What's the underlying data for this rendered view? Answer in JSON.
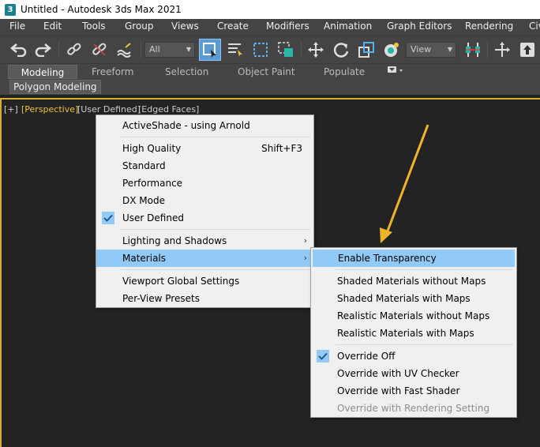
{
  "window": {
    "title": "Untitled - Autodesk 3ds Max 2021",
    "app_icon_text": "3"
  },
  "menubar": {
    "items": [
      "File",
      "Edit",
      "Tools",
      "Group",
      "Views",
      "Create",
      "Modifiers",
      "Animation",
      "Graph Editors",
      "Rendering",
      "Civ"
    ]
  },
  "toolbar": {
    "selection_filter": "All",
    "reference_coord": "View"
  },
  "ribbon": {
    "tabs": [
      "Modeling",
      "Freeform",
      "Selection",
      "Object Paint",
      "Populate"
    ],
    "active_tab": "Modeling",
    "sub_panel": "Polygon Modeling"
  },
  "viewport": {
    "label_plus": "[+]",
    "label_view": "[Perspective]",
    "label_shading": "[User Defined]",
    "label_edged": "[Edged Faces]",
    "border_color": "#d5ac2f",
    "arrow_color": "#f0b429"
  },
  "context_menu": {
    "items": [
      {
        "label": "ActiveShade - using Arnold"
      },
      {
        "label": "High Quality",
        "shortcut": "Shift+F3"
      },
      {
        "label": "Standard"
      },
      {
        "label": "Performance"
      },
      {
        "label": "DX Mode"
      },
      {
        "label": "User Defined",
        "checked": true
      },
      {
        "label": "Lighting and Shadows",
        "submenu": true
      },
      {
        "label": "Materials",
        "submenu": true,
        "highlighted": true
      },
      {
        "label": "Viewport Global Settings"
      },
      {
        "label": "Per-View Presets"
      }
    ]
  },
  "materials_submenu": {
    "items": [
      {
        "label": "Enable Transparency",
        "highlighted": true
      },
      {
        "label": "Shaded Materials without Maps"
      },
      {
        "label": "Shaded Materials with Maps"
      },
      {
        "label": "Realistic Materials without Maps"
      },
      {
        "label": "Realistic Materials with Maps"
      },
      {
        "label": "Override Off",
        "checked": true
      },
      {
        "label": "Override with UV Checker"
      },
      {
        "label": "Override with Fast Shader"
      },
      {
        "label": "Override with Rendering Setting",
        "disabled": true
      }
    ]
  },
  "colors": {
    "menu_highlight": "#91c9f7",
    "check_bg": "#91c9f7"
  },
  "icons": {
    "check": "checkmark-icon",
    "submenu": "chevron-right-icon"
  }
}
